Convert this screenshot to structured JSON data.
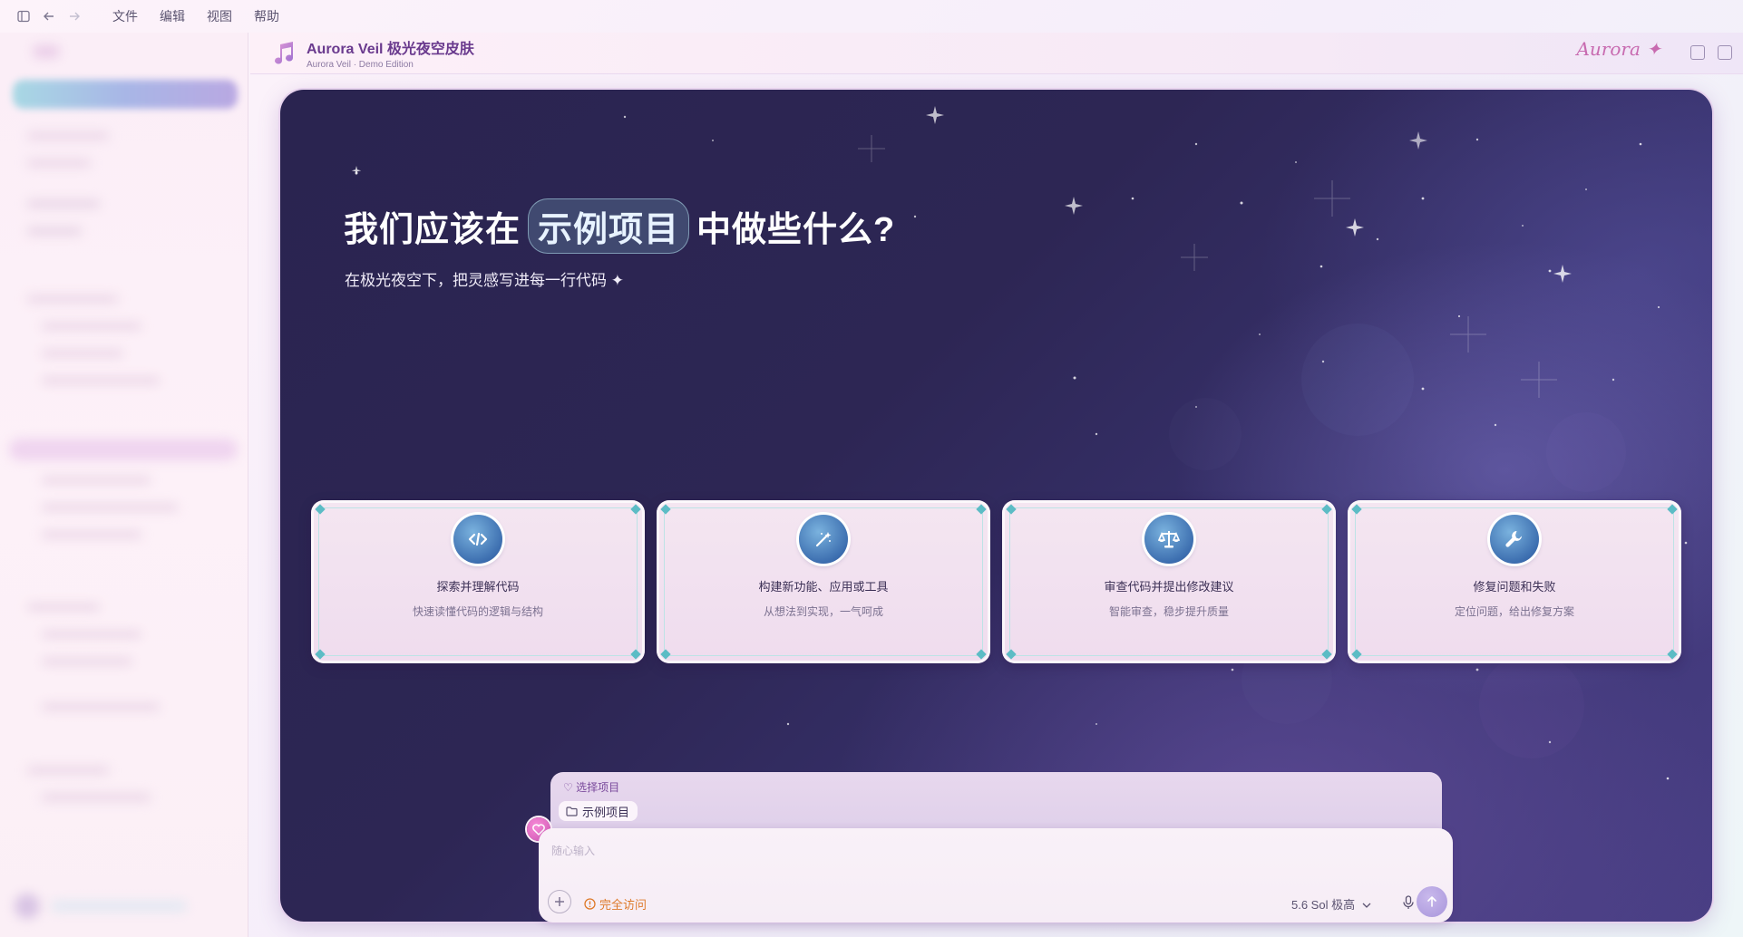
{
  "menubar": {
    "items": [
      "文件",
      "编辑",
      "视图",
      "帮助"
    ]
  },
  "titlebar": {
    "title": "Aurora Veil 极光夜空皮肤",
    "subtitle": "Aurora Veil · Demo Edition",
    "brand": "Aurora ✦"
  },
  "hero": {
    "heading_pre": "我们应该在",
    "heading_project": "示例项目",
    "heading_post": "中做些什么?",
    "subheading": "在极光夜空下，把灵感写进每一行代码 ✦"
  },
  "cards": [
    {
      "icon": "code-icon",
      "title": "探索并理解代码",
      "desc": "快速读懂代码的逻辑与结构"
    },
    {
      "icon": "magic-wand-icon",
      "title": "构建新功能、应用或工具",
      "desc": "从想法到实现，一气呵成"
    },
    {
      "icon": "scale-icon",
      "title": "审查代码并提出修改建议",
      "desc": "智能审查，稳步提升质量"
    },
    {
      "icon": "wrench-icon",
      "title": "修复问题和失败",
      "desc": "定位问题，给出修复方案"
    }
  ],
  "composer": {
    "project_label": "♡ 选择项目",
    "project_chip": "示例项目",
    "placeholder": "随心输入",
    "access": "完全访问",
    "model": "5.6 Sol 极高"
  },
  "colors": {
    "accent_pink": "#d357b5",
    "accent_teal": "#5cbcc5",
    "access_orange": "#de7a2a",
    "title_purple": "#6a3a8e"
  }
}
